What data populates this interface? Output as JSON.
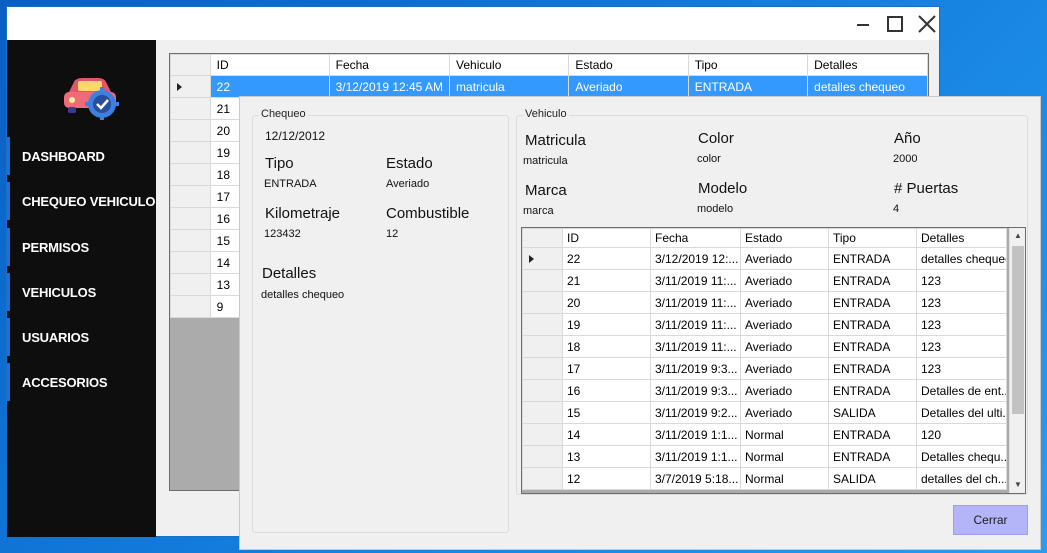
{
  "sidebar": {
    "items": [
      {
        "label": "DASHBOARD"
      },
      {
        "label": "CHEQUEO VEHICULO"
      },
      {
        "label": "PERMISOS"
      },
      {
        "label": "VEHICULOS"
      },
      {
        "label": "USUARIOS"
      },
      {
        "label": "ACCESORIOS"
      }
    ]
  },
  "main_grid": {
    "columns": [
      "ID",
      "Fecha",
      "Vehiculo",
      "Estado",
      "Tipo",
      "Detalles"
    ],
    "selected_row": {
      "id": "22",
      "fecha": "3/12/2019 12:45 AM",
      "vehiculo": "matricula",
      "estado": "Averiado",
      "tipo": "ENTRADA",
      "detalles": "detalles chequeo"
    },
    "ids": [
      "21",
      "20",
      "19",
      "18",
      "17",
      "16",
      "15",
      "14",
      "13",
      "9"
    ]
  },
  "chequeo": {
    "group_title": "Chequeo",
    "fecha": "12/12/2012",
    "tipo_label": "Tipo",
    "tipo_value": "ENTRADA",
    "estado_label": "Estado",
    "estado_value": "Averiado",
    "kilometraje_label": "Kilometraje",
    "kilometraje_value": "123432",
    "combustible_label": "Combustible",
    "combustible_value": "12",
    "detalles_label": "Detalles",
    "detalles_value": "detalles chequeo"
  },
  "vehiculo": {
    "group_title": "Vehiculo",
    "matricula_label": "Matricula",
    "matricula_value": "matricula",
    "color_label": "Color",
    "color_value": "color",
    "anio_label": "Año",
    "anio_value": "2000",
    "marca_label": "Marca",
    "marca_value": "marca",
    "modelo_label": "Modelo",
    "modelo_value": "modelo",
    "puertas_label": "# Puertas",
    "puertas_value": "4"
  },
  "detail_grid": {
    "columns": [
      "ID",
      "Fecha",
      "Estado",
      "Tipo",
      "Detalles"
    ],
    "rows": [
      [
        "22",
        "3/12/2019 12:...",
        "Averiado",
        "ENTRADA",
        "detalles chequeo"
      ],
      [
        "21",
        "3/11/2019 11:...",
        "Averiado",
        "ENTRADA",
        "123"
      ],
      [
        "20",
        "3/11/2019 11:...",
        "Averiado",
        "ENTRADA",
        "123"
      ],
      [
        "19",
        "3/11/2019 11:...",
        "Averiado",
        "ENTRADA",
        "123"
      ],
      [
        "18",
        "3/11/2019 11:...",
        "Averiado",
        "ENTRADA",
        "123"
      ],
      [
        "17",
        "3/11/2019 9:3...",
        "Averiado",
        "ENTRADA",
        "123"
      ],
      [
        "16",
        "3/11/2019 9:3...",
        "Averiado",
        "ENTRADA",
        "Detalles de ent..."
      ],
      [
        "15",
        "3/11/2019 9:2...",
        "Averiado",
        "SALIDA",
        "Detalles del ulti..."
      ],
      [
        "14",
        "3/11/2019 1:1...",
        "Normal",
        "ENTRADA",
        "120"
      ],
      [
        "13",
        "3/11/2019 1:1...",
        "Normal",
        "ENTRADA",
        "Detalles chequ..."
      ],
      [
        "12",
        "3/7/2019 5:18...",
        "Normal",
        "SALIDA",
        "detalles del ch..."
      ]
    ]
  },
  "close_label": "Cerrar"
}
